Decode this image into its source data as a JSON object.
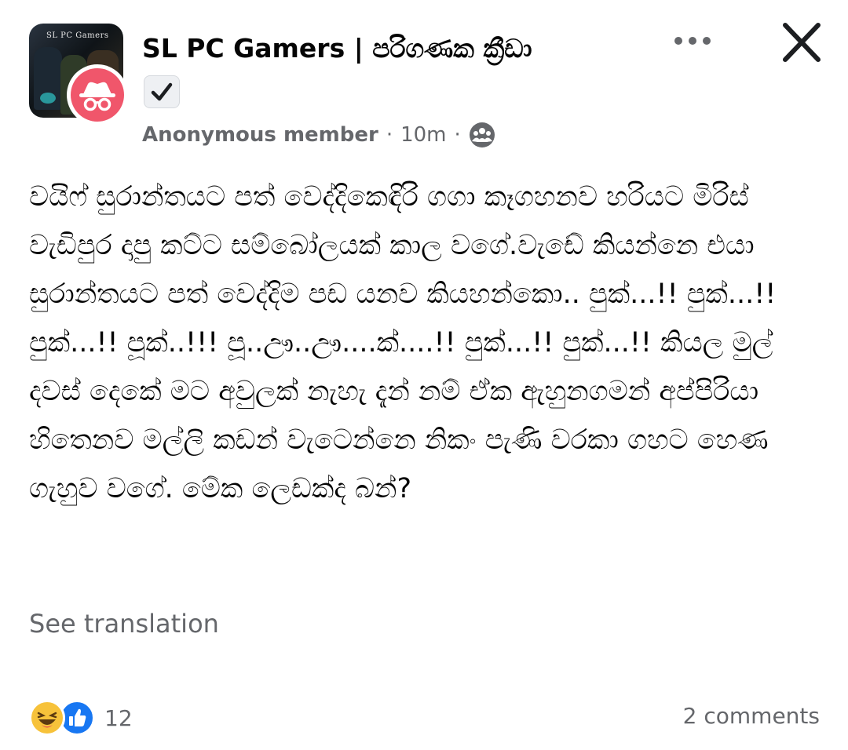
{
  "group": {
    "name": "SL PC Gamers | පරිගණක ක්‍රීඩා",
    "avatar_banner": "SL PC Gamers",
    "avatar_icon": "group-cover-image",
    "badge_icon": "anonymous-spy-icon"
  },
  "post_meta": {
    "author": "Anonymous member",
    "separator": "·",
    "time": "10m",
    "audience_icon": "group-members-icon"
  },
  "post": {
    "body": "වයිෆ් සුරාන්තයට පත් වෙද්දිකෙඳිරි ගගා කෑගහනව හරියට මිරිස් වැඩිපුර දාපු කට්ට සම්බෝලයක් කාල වගේ.වැඩේ කියන්නෙ එයා සුරාන්තයට පත් වෙද්දිම පඩ යනව කියහන්කො.. පුක්...!! පුක්...!! පුක්...!! පූක්..!!! පූ..ඌ..ඌ....ක්....!! පුක්...!! පුක්...!! කියල මුල් දවස් දෙකේ මට අවුලක් නැහැ දැන් නම් ඒක ඇහුනගමන් අප්පිරියා හිතෙනව මල්ලි කඩන් වැටෙන්නෙ නිකං පැණි වරකා ගහට හෙණ ගැහුව වගේ. මේක ලෙඩක්ද බන්?",
    "see_translation": "See translation"
  },
  "footer": {
    "reactions": [
      "haha",
      "like"
    ],
    "reaction_count": "12",
    "comments": "2 comments"
  },
  "colors": {
    "text": "#050505",
    "secondary": "#65676b",
    "like_blue": "#1877f2",
    "haha_yellow": "#f7c23a",
    "anon_badge": "#f0566b"
  }
}
